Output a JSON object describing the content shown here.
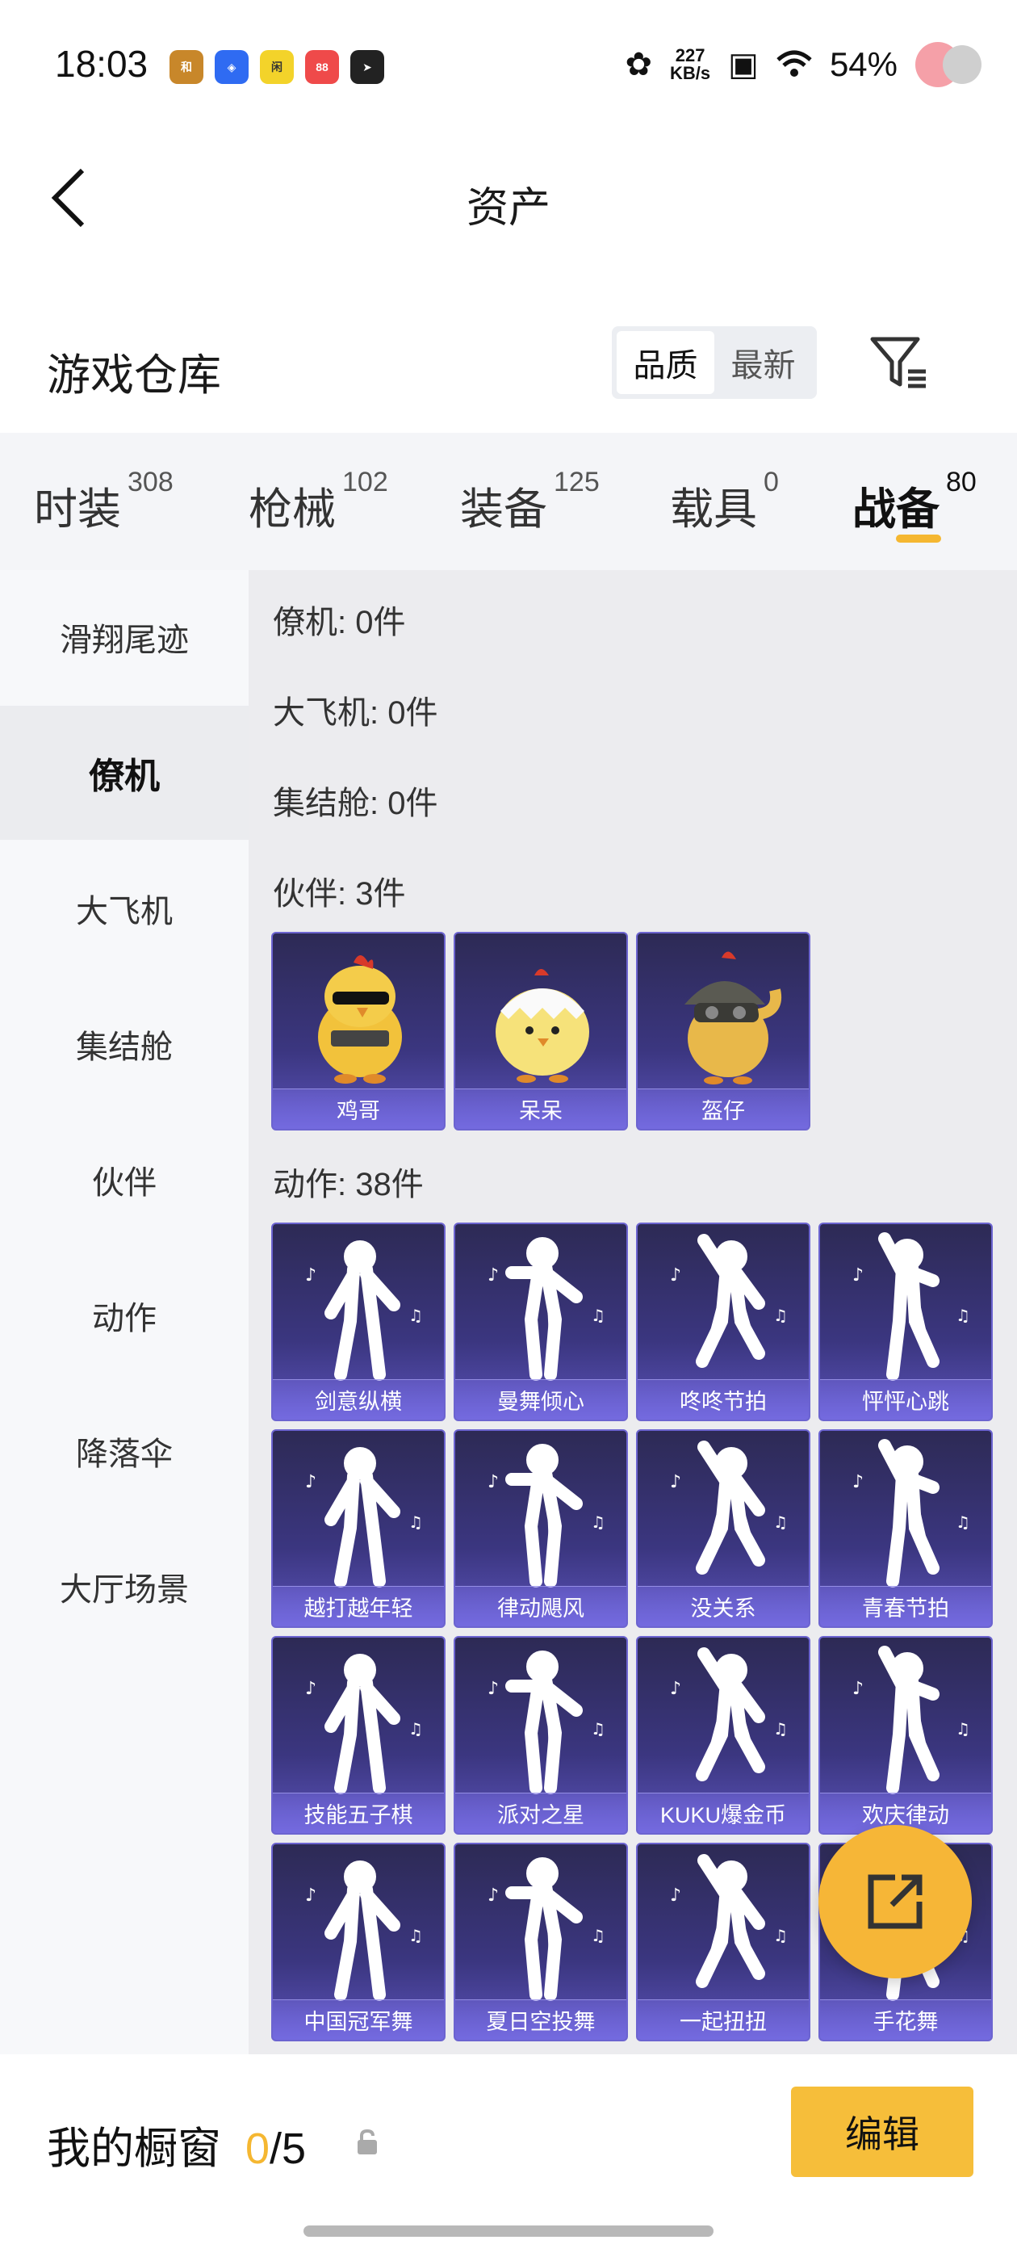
{
  "status_bar": {
    "time": "18:03",
    "app_icons": [
      {
        "name": "game-app-icon",
        "color": "#c8872a",
        "label": "和"
      },
      {
        "name": "blue-app-icon",
        "color": "#2f6bf2",
        "label": "◈"
      },
      {
        "name": "yellow-app-icon",
        "color": "#f3d32a",
        "label": "闲"
      },
      {
        "name": "red-app-icon",
        "color": "#ef4a4a",
        "label": "88"
      },
      {
        "name": "send-app-icon",
        "color": "#222222",
        "label": "➤"
      }
    ],
    "speed_top": "227",
    "speed_bottom": "KB/s",
    "battery": "54%"
  },
  "header": {
    "title": "资产"
  },
  "warehouse": {
    "title": "游戏仓库",
    "sort_options": [
      "品质",
      "最新"
    ],
    "active_sort": "品质"
  },
  "tabs": [
    {
      "label": "时装",
      "count": "308"
    },
    {
      "label": "枪械",
      "count": "102"
    },
    {
      "label": "装备",
      "count": "125"
    },
    {
      "label": "载具",
      "count": "0"
    },
    {
      "label": "战备",
      "count": "80"
    }
  ],
  "sidebar": {
    "items": [
      "滑翔尾迹",
      "僚机",
      "大飞机",
      "集结舱",
      "伙伴",
      "动作",
      "降落伞",
      "大厅场景"
    ],
    "active": "僚机"
  },
  "content": {
    "sections": [
      "僚机: 0件",
      "大飞机: 0件",
      "集结舱: 0件",
      "伙伴: 3件",
      "动作: 38件"
    ],
    "partners": [
      "鸡哥",
      "呆呆",
      "盔仔"
    ],
    "actions": [
      "剑意纵横",
      "曼舞倾心",
      "咚咚节拍",
      "怦怦心跳",
      "越打越年轻",
      "律动飓风",
      "没关系",
      "青春节拍",
      "技能五子棋",
      "派对之星",
      "KUKU爆金币",
      "欢庆律动",
      "中国冠军舞",
      "夏日空投舞",
      "一起扭扭",
      "手花舞"
    ]
  },
  "bottom_bar": {
    "showcase_label": "我的橱窗",
    "count_current": "0",
    "count_total": "/5",
    "edit_label": "编辑"
  },
  "colors": {
    "accent": "#f5b731",
    "card_bg": "#3b3680"
  }
}
